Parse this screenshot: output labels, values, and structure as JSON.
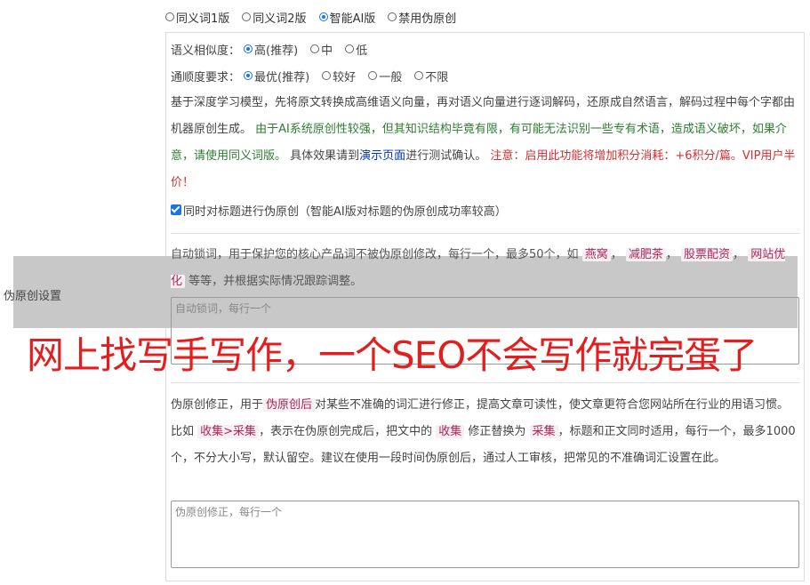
{
  "version_options": [
    {
      "label": "同义词1版",
      "checked": false
    },
    {
      "label": "同义词2版",
      "checked": false
    },
    {
      "label": "智能AI版",
      "checked": true
    },
    {
      "label": "禁用伪原创",
      "checked": false
    }
  ],
  "similarity": {
    "label": "语义相似度：",
    "options": [
      {
        "label": "高(推荐)",
        "checked": true
      },
      {
        "label": "中",
        "checked": false
      },
      {
        "label": "低",
        "checked": false
      }
    ]
  },
  "fluency": {
    "label": "通顺度要求：",
    "options": [
      {
        "label": "最优(推荐)",
        "checked": true
      },
      {
        "label": "较好",
        "checked": false
      },
      {
        "label": "一般",
        "checked": false
      },
      {
        "label": "不限",
        "checked": false
      }
    ]
  },
  "description": {
    "part1": "基于深度学习模型，先将原文转换成高维语义向量，再对语义向量进行逐词解码，还原成自然语言，解码过程中每个字都由机器原创生成。",
    "part2_green": "由于AI系统原创性较强，但其知识结构毕竟有限，有可能无法识别一些专有术语，造成语义破坏，如果介意，请使用同义词版。",
    "part3": "具体效果请到",
    "part4_link": "演示页面",
    "part5": "进行测试确认。",
    "part6_red": "注意：启用此功能将增加积分消耗：+6积分/篇。VIP用户半价！"
  },
  "title_checkbox": {
    "label": "同时对标题进行伪原创（智能AI版对标题的伪原创成功率较高）",
    "checked": true
  },
  "side_label": "伪原创设置",
  "lock_words": {
    "text_before": "自动锁词，用于保护您的核心产品词不被伪原创修改，每行一个，最多50个，如",
    "examples": [
      "燕窝",
      "减肥茶",
      "股票配资",
      "网站优化"
    ],
    "sep": "，",
    "text_after": "等等，并根据实际情况跟踪调整。",
    "placeholder": "自动锁词，每行一个"
  },
  "overlay_title": "网上找写手写作，一个SEO不会写作就完蛋了",
  "correction": {
    "t1": "伪原创修正，用于",
    "tag1": "伪原创后",
    "t2": "对某些不准确的词汇进行修正，提高文章可读性，使文章更符合您网站所在行业的用语习惯。比如",
    "tag2": "收集>采集",
    "t3": "，表示在伪原创完成后，把文中的",
    "tag3": "收集",
    "t4": "修正替换为",
    "tag4": "采集",
    "t5": "，标题和正文同时适用，每行一个，最多1000个，不分大小写，默认留空。建议在使用一段时间伪原创后，通过人工审核，把常见的不准确词汇设置在此。",
    "placeholder": "伪原创修正，每行一个"
  },
  "colors": {
    "accent": "#1a73e8",
    "green": "#2e7d32",
    "red": "#d32f2f",
    "overlay": "#e31e1e"
  }
}
